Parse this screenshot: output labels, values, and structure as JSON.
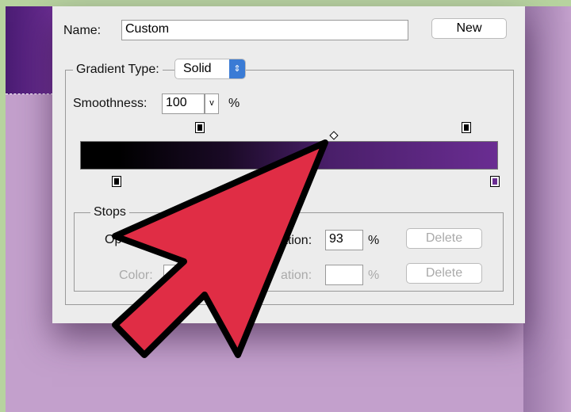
{
  "dialog": {
    "name_label": "Name:",
    "name_value": "Custom",
    "new_button": "New",
    "gradient_type_label": "Gradient Type:",
    "gradient_type_value": "Solid",
    "smoothness_label": "Smoothness:",
    "smoothness_value": "100",
    "percent": "%",
    "stops": {
      "title": "Stops",
      "opacity_label": "Op",
      "location_label_1": "ation:",
      "location_value_1": "93",
      "delete_1": "Delete",
      "color_label": "Color:",
      "location_label_2": "ation:",
      "location_value_2": "",
      "delete_2": "Delete"
    }
  },
  "gradient": {
    "start_color": "#000000",
    "end_color": "#6a2d92",
    "midpoint_percent": 59,
    "opacity_stops_percent": [
      29,
      93
    ],
    "color_stops_percent": [
      9,
      100
    ]
  },
  "colors": {
    "arrow": "#e02d45",
    "background": "#c3a0cc",
    "accent": "#3a7bd5"
  }
}
